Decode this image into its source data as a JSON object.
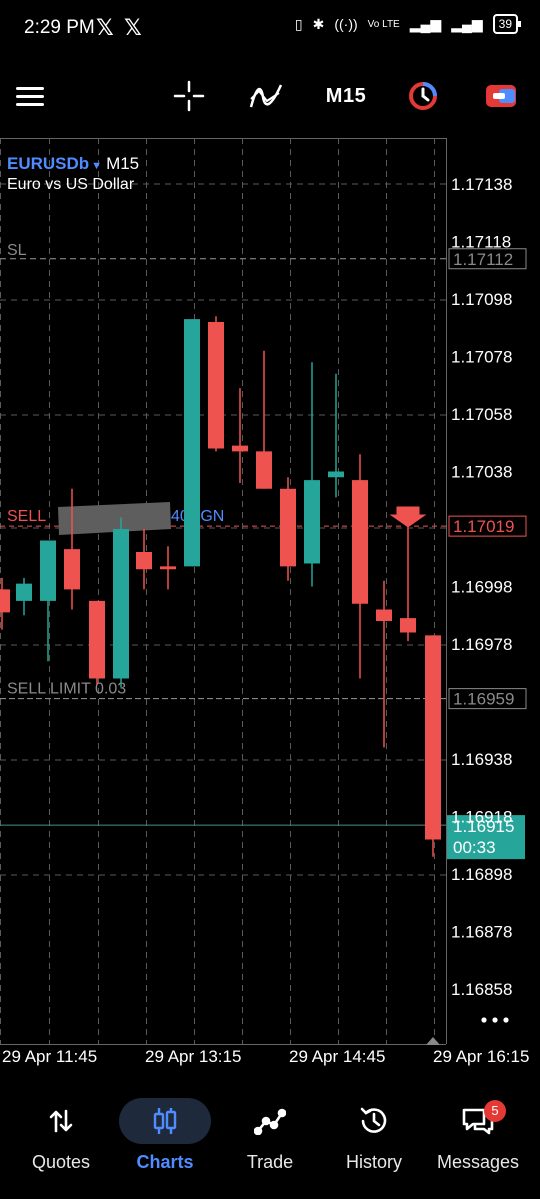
{
  "status_bar": {
    "time": "2:29 PM",
    "battery": "39"
  },
  "toolbar": {
    "timeframe": "M15"
  },
  "chart": {
    "symbol": "EURUSDb",
    "timeframe": "M15",
    "description": "Euro vs US Dollar",
    "sl_label": "SL",
    "sl_price": "1.17112",
    "sell_label_left": "SELL",
    "sell_label_right": "40NGN",
    "sell_price": "1.17019",
    "sell_limit_label": "SELL LIMIT 0.03",
    "sell_limit_price": "1.16959",
    "current_price": "1.16915",
    "countdown": "00:33",
    "price_labels": [
      "1.17138",
      "1.17118",
      "1.17098",
      "1.17078",
      "1.17058",
      "1.17038",
      "1.16998",
      "1.16978",
      "1.16938",
      "1.16918",
      "1.16898",
      "1.16878",
      "1.16858"
    ],
    "time_labels": [
      "29 Apr 11:45",
      "29 Apr 13:15",
      "29 Apr 14:45",
      "29 Apr 16:15"
    ],
    "candles": [
      {
        "o": 1.16997,
        "h": 1.17001,
        "l": 1.16983,
        "c": 1.16989
      },
      {
        "o": 1.16993,
        "h": 1.17001,
        "l": 1.16988,
        "c": 1.16999
      },
      {
        "o": 1.16993,
        "h": 1.17014,
        "l": 1.16972,
        "c": 1.17014
      },
      {
        "o": 1.17011,
        "h": 1.17032,
        "l": 1.1699,
        "c": 1.16997
      },
      {
        "o": 1.16993,
        "h": 1.16993,
        "l": 1.16964,
        "c": 1.16966
      },
      {
        "o": 1.16966,
        "h": 1.17022,
        "l": 1.16963,
        "c": 1.17018
      },
      {
        "o": 1.1701,
        "h": 1.17018,
        "l": 1.16997,
        "c": 1.17004
      },
      {
        "o": 1.17005,
        "h": 1.17012,
        "l": 1.16997,
        "c": 1.17004
      },
      {
        "o": 1.17005,
        "h": 1.17091,
        "l": 1.17005,
        "c": 1.17091
      },
      {
        "o": 1.1709,
        "h": 1.17092,
        "l": 1.17045,
        "c": 1.17046
      },
      {
        "o": 1.17047,
        "h": 1.17067,
        "l": 1.17034,
        "c": 1.17045
      },
      {
        "o": 1.17045,
        "h": 1.1708,
        "l": 1.17032,
        "c": 1.17032
      },
      {
        "o": 1.17032,
        "h": 1.17036,
        "l": 1.17,
        "c": 1.17005
      },
      {
        "o": 1.17006,
        "h": 1.17076,
        "l": 1.16998,
        "c": 1.17035
      },
      {
        "o": 1.17036,
        "h": 1.17072,
        "l": 1.17029,
        "c": 1.17038
      },
      {
        "o": 1.17035,
        "h": 1.17044,
        "l": 1.16966,
        "c": 1.16992
      },
      {
        "o": 1.1699,
        "h": 1.17,
        "l": 1.16942,
        "c": 1.16986
      },
      {
        "o": 1.16987,
        "h": 1.17019,
        "l": 1.16979,
        "c": 1.16982
      },
      {
        "o": 1.16981,
        "h": 1.16981,
        "l": 1.16904,
        "c": 1.1691
      }
    ]
  },
  "nav": {
    "quotes": "Quotes",
    "charts": "Charts",
    "trade": "Trade",
    "history": "History",
    "messages": "Messages",
    "messages_badge": "5"
  },
  "colors": {
    "bull": "#26a69a",
    "bear": "#ef5350",
    "grid": "#5a5a5a",
    "accent": "#4f8cff"
  },
  "icons": [
    "menu-icon",
    "crosshair-icon",
    "indicators-icon",
    "timer-icon",
    "trade-toggle-icon",
    "sort-arrows-icon",
    "candles-icon",
    "trend-icon",
    "history-icon",
    "message-icon",
    "more-icon",
    "sell-arrow-icon"
  ]
}
